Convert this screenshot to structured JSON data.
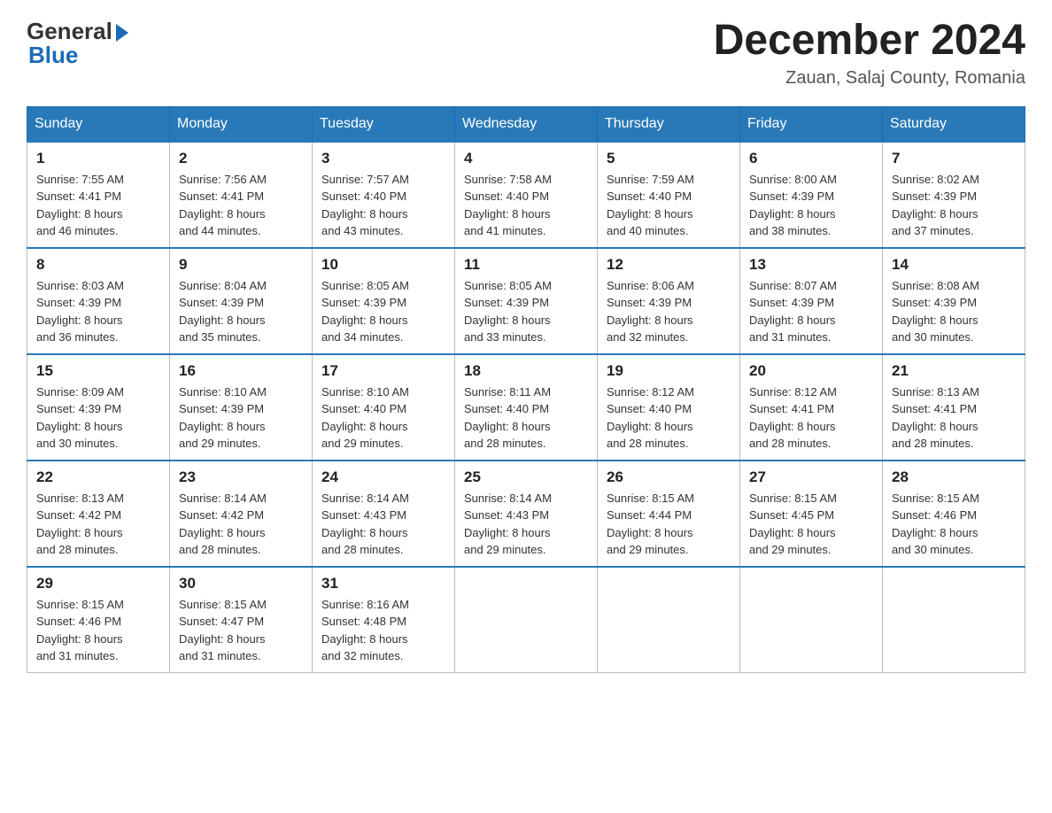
{
  "logo": {
    "general": "General",
    "blue": "Blue"
  },
  "title": "December 2024",
  "location": "Zauan, Salaj County, Romania",
  "days_of_week": [
    "Sunday",
    "Monday",
    "Tuesday",
    "Wednesday",
    "Thursday",
    "Friday",
    "Saturday"
  ],
  "weeks": [
    [
      {
        "day": "1",
        "sunrise": "7:55 AM",
        "sunset": "4:41 PM",
        "daylight": "8 hours and 46 minutes."
      },
      {
        "day": "2",
        "sunrise": "7:56 AM",
        "sunset": "4:41 PM",
        "daylight": "8 hours and 44 minutes."
      },
      {
        "day": "3",
        "sunrise": "7:57 AM",
        "sunset": "4:40 PM",
        "daylight": "8 hours and 43 minutes."
      },
      {
        "day": "4",
        "sunrise": "7:58 AM",
        "sunset": "4:40 PM",
        "daylight": "8 hours and 41 minutes."
      },
      {
        "day": "5",
        "sunrise": "7:59 AM",
        "sunset": "4:40 PM",
        "daylight": "8 hours and 40 minutes."
      },
      {
        "day": "6",
        "sunrise": "8:00 AM",
        "sunset": "4:39 PM",
        "daylight": "8 hours and 38 minutes."
      },
      {
        "day": "7",
        "sunrise": "8:02 AM",
        "sunset": "4:39 PM",
        "daylight": "8 hours and 37 minutes."
      }
    ],
    [
      {
        "day": "8",
        "sunrise": "8:03 AM",
        "sunset": "4:39 PM",
        "daylight": "8 hours and 36 minutes."
      },
      {
        "day": "9",
        "sunrise": "8:04 AM",
        "sunset": "4:39 PM",
        "daylight": "8 hours and 35 minutes."
      },
      {
        "day": "10",
        "sunrise": "8:05 AM",
        "sunset": "4:39 PM",
        "daylight": "8 hours and 34 minutes."
      },
      {
        "day": "11",
        "sunrise": "8:05 AM",
        "sunset": "4:39 PM",
        "daylight": "8 hours and 33 minutes."
      },
      {
        "day": "12",
        "sunrise": "8:06 AM",
        "sunset": "4:39 PM",
        "daylight": "8 hours and 32 minutes."
      },
      {
        "day": "13",
        "sunrise": "8:07 AM",
        "sunset": "4:39 PM",
        "daylight": "8 hours and 31 minutes."
      },
      {
        "day": "14",
        "sunrise": "8:08 AM",
        "sunset": "4:39 PM",
        "daylight": "8 hours and 30 minutes."
      }
    ],
    [
      {
        "day": "15",
        "sunrise": "8:09 AM",
        "sunset": "4:39 PM",
        "daylight": "8 hours and 30 minutes."
      },
      {
        "day": "16",
        "sunrise": "8:10 AM",
        "sunset": "4:39 PM",
        "daylight": "8 hours and 29 minutes."
      },
      {
        "day": "17",
        "sunrise": "8:10 AM",
        "sunset": "4:40 PM",
        "daylight": "8 hours and 29 minutes."
      },
      {
        "day": "18",
        "sunrise": "8:11 AM",
        "sunset": "4:40 PM",
        "daylight": "8 hours and 28 minutes."
      },
      {
        "day": "19",
        "sunrise": "8:12 AM",
        "sunset": "4:40 PM",
        "daylight": "8 hours and 28 minutes."
      },
      {
        "day": "20",
        "sunrise": "8:12 AM",
        "sunset": "4:41 PM",
        "daylight": "8 hours and 28 minutes."
      },
      {
        "day": "21",
        "sunrise": "8:13 AM",
        "sunset": "4:41 PM",
        "daylight": "8 hours and 28 minutes."
      }
    ],
    [
      {
        "day": "22",
        "sunrise": "8:13 AM",
        "sunset": "4:42 PM",
        "daylight": "8 hours and 28 minutes."
      },
      {
        "day": "23",
        "sunrise": "8:14 AM",
        "sunset": "4:42 PM",
        "daylight": "8 hours and 28 minutes."
      },
      {
        "day": "24",
        "sunrise": "8:14 AM",
        "sunset": "4:43 PM",
        "daylight": "8 hours and 28 minutes."
      },
      {
        "day": "25",
        "sunrise": "8:14 AM",
        "sunset": "4:43 PM",
        "daylight": "8 hours and 29 minutes."
      },
      {
        "day": "26",
        "sunrise": "8:15 AM",
        "sunset": "4:44 PM",
        "daylight": "8 hours and 29 minutes."
      },
      {
        "day": "27",
        "sunrise": "8:15 AM",
        "sunset": "4:45 PM",
        "daylight": "8 hours and 29 minutes."
      },
      {
        "day": "28",
        "sunrise": "8:15 AM",
        "sunset": "4:46 PM",
        "daylight": "8 hours and 30 minutes."
      }
    ],
    [
      {
        "day": "29",
        "sunrise": "8:15 AM",
        "sunset": "4:46 PM",
        "daylight": "8 hours and 31 minutes."
      },
      {
        "day": "30",
        "sunrise": "8:15 AM",
        "sunset": "4:47 PM",
        "daylight": "8 hours and 31 minutes."
      },
      {
        "day": "31",
        "sunrise": "8:16 AM",
        "sunset": "4:48 PM",
        "daylight": "8 hours and 32 minutes."
      },
      null,
      null,
      null,
      null
    ]
  ],
  "labels": {
    "sunrise": "Sunrise:",
    "sunset": "Sunset:",
    "daylight": "Daylight:"
  }
}
